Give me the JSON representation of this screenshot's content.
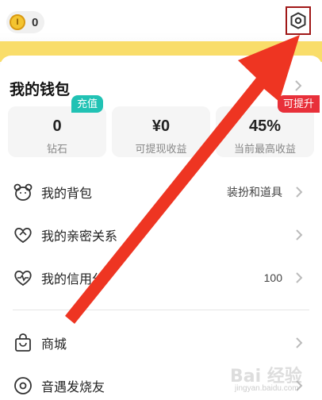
{
  "header": {
    "coin_count": "0",
    "coin_symbol": "I"
  },
  "wallet": {
    "title": "我的钱包",
    "stats": [
      {
        "value": "0",
        "label": "钻石"
      },
      {
        "value": "¥0",
        "label": "可提现收益"
      },
      {
        "value": "45%",
        "label": "当前最高收益"
      }
    ],
    "badges": {
      "recharge": "充值",
      "withdraw": "可提升"
    }
  },
  "menu": [
    {
      "label": "我的背包",
      "right": "装扮和道具",
      "icon": "bear-face-icon"
    },
    {
      "label": "我的亲密关系",
      "right": "",
      "icon": "hearts-icon"
    },
    {
      "label": "我的信用分",
      "right": "100",
      "icon": "heart-pulse-icon"
    },
    {
      "label": "商城",
      "right": "",
      "icon": "shopping-bag-icon"
    },
    {
      "label": "音遇发烧友",
      "right": "",
      "icon": "vinyl-disc-icon"
    }
  ],
  "watermark": {
    "logo": "Bai 经验",
    "sub": "jingyan.baidu.com"
  },
  "colors": {
    "accent_yellow": "#f9dd6a",
    "badge_teal": "#21c2b4",
    "badge_red": "#e8303a",
    "arrow_red": "#ee3522",
    "highlight_box": "#a01818"
  }
}
